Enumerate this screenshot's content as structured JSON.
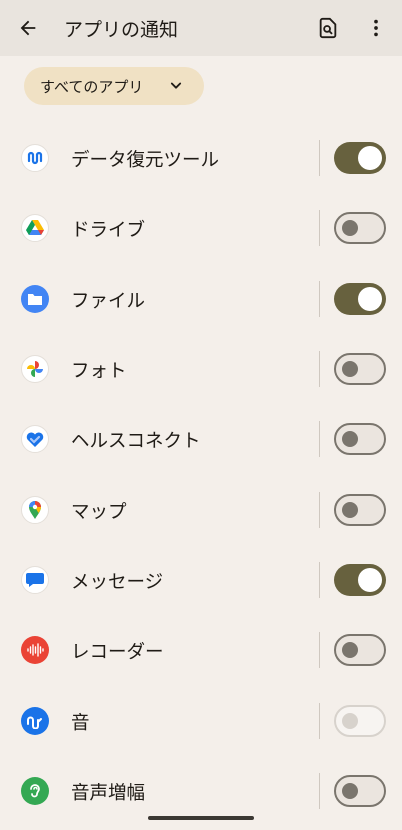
{
  "header": {
    "title": "アプリの通知",
    "back_icon": "arrow-back-icon",
    "search_icon": "search-in-page-icon",
    "more_icon": "more-vert-icon"
  },
  "filter": {
    "label": "すべてのアプリ",
    "icon": "chevron-down-icon"
  },
  "apps": [
    {
      "name": "データ復元ツール",
      "icon": "data-restore-icon",
      "toggle": "on"
    },
    {
      "name": "ドライブ",
      "icon": "drive-icon",
      "toggle": "off"
    },
    {
      "name": "ファイル",
      "icon": "files-icon",
      "toggle": "on"
    },
    {
      "name": "フォト",
      "icon": "photos-icon",
      "toggle": "off"
    },
    {
      "name": "ヘルスコネクト",
      "icon": "health-connect-icon",
      "toggle": "off"
    },
    {
      "name": "マップ",
      "icon": "maps-icon",
      "toggle": "off"
    },
    {
      "name": "メッセージ",
      "icon": "messages-icon",
      "toggle": "on"
    },
    {
      "name": "レコーダー",
      "icon": "recorder-icon",
      "toggle": "off"
    },
    {
      "name": "音",
      "icon": "sound-icon",
      "toggle": "disabled"
    },
    {
      "name": "音声増幅",
      "icon": "sound-amplifier-icon",
      "toggle": "off"
    }
  ],
  "colors": {
    "background": "#f4efea",
    "header": "#e9e4de",
    "chip": "#f0e1c4",
    "toggle_on": "#67613e",
    "toggle_off_track": "#ebe5df",
    "toggle_off_outline": "#7a756d"
  }
}
